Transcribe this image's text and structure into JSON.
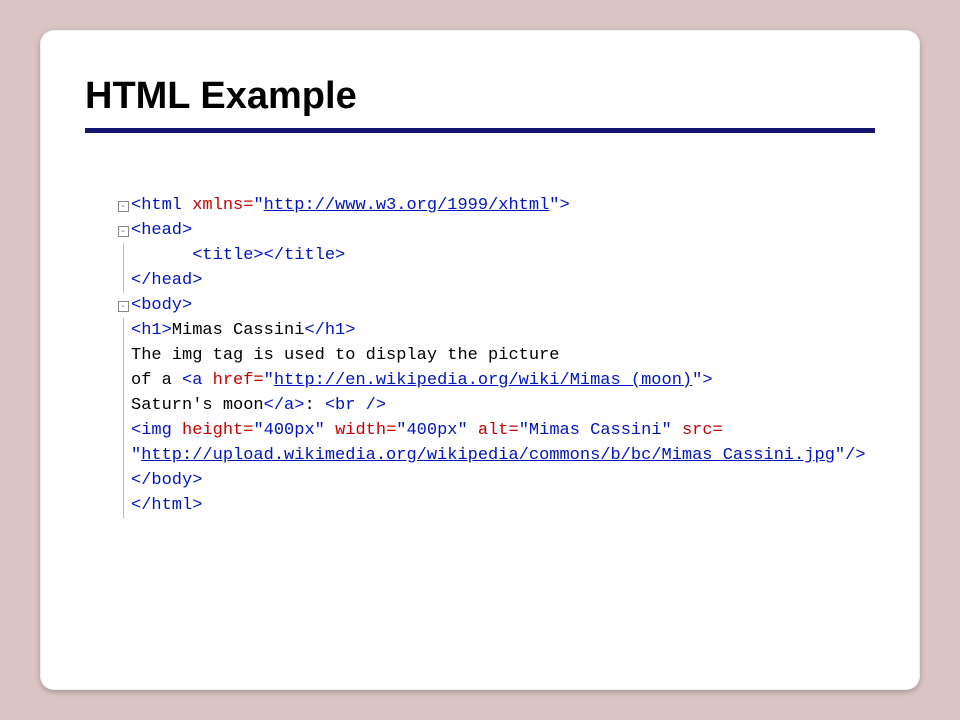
{
  "slide": {
    "title": "HTML Example"
  },
  "code": {
    "toggle_glyph": "-",
    "lines": {
      "l1_open": "<html ",
      "l1_attr": "xmlns=",
      "l1_q1": "\"",
      "l1_url": "http://www.w3.org/1999/xhtml",
      "l1_q2": "\"",
      "l1_close": ">",
      "l2": "<head>",
      "l3_indent": "      ",
      "l3_open": "<title>",
      "l3_close": "</title>",
      "l4": "</head>",
      "l5": "<body>",
      "l6_open": "<h1>",
      "l6_text": "Mimas Cassini",
      "l6_close": "</h1>",
      "l7": "The img tag is used to display the picture",
      "l8_pre": "of a ",
      "l8_open": "<a ",
      "l8_attr": "href=",
      "l8_q1": "\"",
      "l8_url": "http://en.wikipedia.org/wiki/Mimas_(moon)",
      "l8_q2": "\"",
      "l8_close": ">",
      "l9_text": "Saturn's moon",
      "l9_aclose": "</a>",
      "l9_colon": ": ",
      "l9_br": "<br />",
      "l10_open": "<img  ",
      "l10_a1": "height=",
      "l10_v1": "\"400px\" ",
      "l10_a2": "width=",
      "l10_v2": "\"400px\" ",
      "l10_a3": "alt=",
      "l10_v3": "\"Mimas Cassini\" ",
      "l10_a4": "src=",
      "l11_q1": "\"",
      "l11_url": "http://upload.wikimedia.org/wikipedia/commons/b/bc/Mimas_Cassini.jpg",
      "l11_q2": "\"",
      "l11_close": "/>",
      "l12": "</body>",
      "l13": "</html>"
    }
  }
}
